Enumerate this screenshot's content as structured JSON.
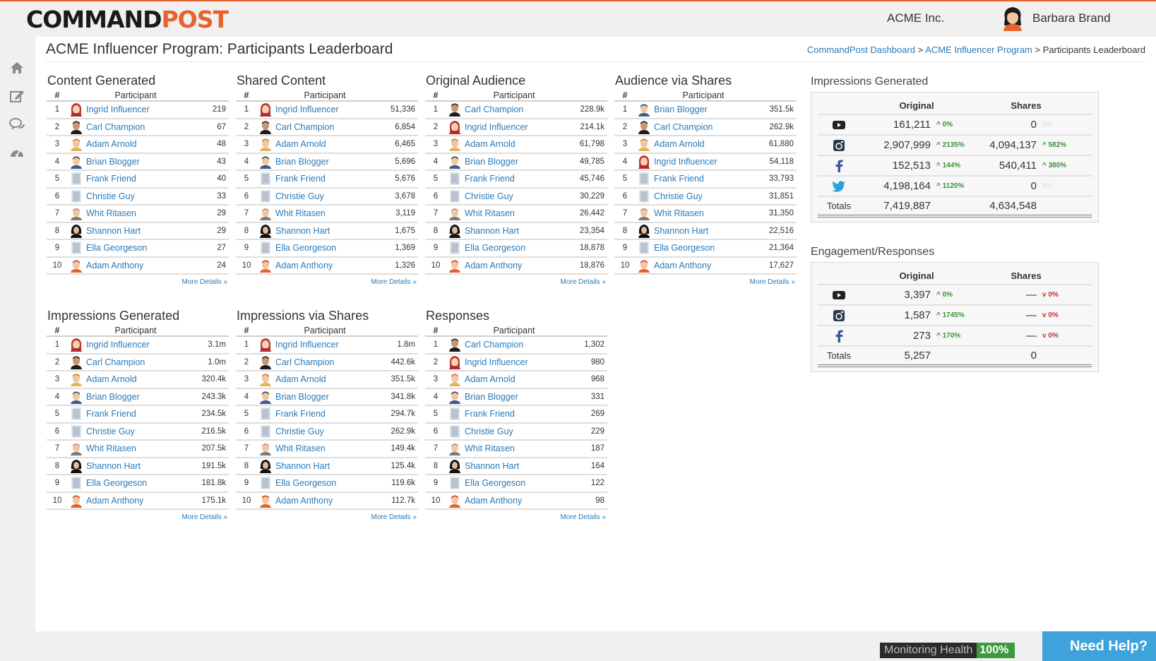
{
  "header": {
    "logo_left": "COMMAND",
    "logo_right": "POST",
    "company": "ACME Inc.",
    "user_name": "Barbara Brand"
  },
  "page": {
    "title": "ACME Influencer Program: Participants Leaderboard",
    "breadcrumb": {
      "link1": "CommandPost Dashboard",
      "sep": ">",
      "link2": "ACME Influencer Program",
      "current": "Participants Leaderboard"
    }
  },
  "sidebar": [
    "home-icon",
    "edit-icon",
    "chat-icon",
    "dashboard-icon"
  ],
  "board_labels": {
    "num_header": "#",
    "participant_header": "Participant",
    "more": "More Details »"
  },
  "boards": [
    {
      "title": "Content Generated",
      "rows": [
        {
          "n": "1",
          "name": "Ingrid Influencer",
          "avatar": "ingrid",
          "value": "219"
        },
        {
          "n": "2",
          "name": "Carl Champion",
          "avatar": "carl",
          "value": "67"
        },
        {
          "n": "3",
          "name": "Adam Arnold",
          "avatar": "adam",
          "value": "48"
        },
        {
          "n": "4",
          "name": "Brian Blogger",
          "avatar": "brian",
          "value": "43"
        },
        {
          "n": "5",
          "name": "Frank Friend",
          "avatar": "blank",
          "value": "40"
        },
        {
          "n": "6",
          "name": "Christie Guy",
          "avatar": "blank",
          "value": "33"
        },
        {
          "n": "7",
          "name": "Whit Ritasen",
          "avatar": "whit",
          "value": "29"
        },
        {
          "n": "8",
          "name": "Shannon Hart",
          "avatar": "shannon",
          "value": "29"
        },
        {
          "n": "9",
          "name": "Ella Georgeson",
          "avatar": "blank",
          "value": "27"
        },
        {
          "n": "10",
          "name": "Adam Anthony",
          "avatar": "anthony",
          "value": "24"
        }
      ]
    },
    {
      "title": "Shared Content",
      "rows": [
        {
          "n": "1",
          "name": "Ingrid Influencer",
          "avatar": "ingrid",
          "value": "51,336"
        },
        {
          "n": "2",
          "name": "Carl Champion",
          "avatar": "carl",
          "value": "6,854"
        },
        {
          "n": "3",
          "name": "Adam Arnold",
          "avatar": "adam",
          "value": "6,465"
        },
        {
          "n": "4",
          "name": "Brian Blogger",
          "avatar": "brian",
          "value": "5,696"
        },
        {
          "n": "5",
          "name": "Frank Friend",
          "avatar": "blank",
          "value": "5,676"
        },
        {
          "n": "6",
          "name": "Christie Guy",
          "avatar": "blank",
          "value": "3,678"
        },
        {
          "n": "7",
          "name": "Whit Ritasen",
          "avatar": "whit",
          "value": "3,119"
        },
        {
          "n": "8",
          "name": "Shannon Hart",
          "avatar": "shannon",
          "value": "1,675"
        },
        {
          "n": "9",
          "name": "Ella Georgeson",
          "avatar": "blank",
          "value": "1,369"
        },
        {
          "n": "10",
          "name": "Adam Anthony",
          "avatar": "anthony",
          "value": "1,326"
        }
      ]
    },
    {
      "title": "Original Audience",
      "rows": [
        {
          "n": "1",
          "name": "Carl Champion",
          "avatar": "carl",
          "value": "228.9k"
        },
        {
          "n": "2",
          "name": "Ingrid Influencer",
          "avatar": "ingrid",
          "value": "214.1k"
        },
        {
          "n": "3",
          "name": "Adam Arnold",
          "avatar": "adam",
          "value": "61,798"
        },
        {
          "n": "4",
          "name": "Brian Blogger",
          "avatar": "brian",
          "value": "49,785"
        },
        {
          "n": "5",
          "name": "Frank Friend",
          "avatar": "blank",
          "value": "45,746"
        },
        {
          "n": "6",
          "name": "Christie Guy",
          "avatar": "blank",
          "value": "30,229"
        },
        {
          "n": "7",
          "name": "Whit Ritasen",
          "avatar": "whit",
          "value": "26,442"
        },
        {
          "n": "8",
          "name": "Shannon Hart",
          "avatar": "shannon",
          "value": "23,354"
        },
        {
          "n": "9",
          "name": "Ella Georgeson",
          "avatar": "blank",
          "value": "18,878"
        },
        {
          "n": "10",
          "name": "Adam Anthony",
          "avatar": "anthony",
          "value": "18,876"
        }
      ]
    },
    {
      "title": "Audience via Shares",
      "rows": [
        {
          "n": "1",
          "name": "Brian Blogger",
          "avatar": "brian",
          "value": "351.5k"
        },
        {
          "n": "2",
          "name": "Carl Champion",
          "avatar": "carl",
          "value": "262.9k"
        },
        {
          "n": "3",
          "name": "Adam Arnold",
          "avatar": "adam",
          "value": "61,880"
        },
        {
          "n": "4",
          "name": "Ingrid Influencer",
          "avatar": "ingrid",
          "value": "54,118"
        },
        {
          "n": "5",
          "name": "Frank Friend",
          "avatar": "blank",
          "value": "33,793"
        },
        {
          "n": "6",
          "name": "Christie Guy",
          "avatar": "blank",
          "value": "31,851"
        },
        {
          "n": "7",
          "name": "Whit Ritasen",
          "avatar": "whit",
          "value": "31,350"
        },
        {
          "n": "8",
          "name": "Shannon Hart",
          "avatar": "shannon",
          "value": "22,516"
        },
        {
          "n": "9",
          "name": "Ella Georgeson",
          "avatar": "blank",
          "value": "21,364"
        },
        {
          "n": "10",
          "name": "Adam Anthony",
          "avatar": "anthony",
          "value": "17,627"
        }
      ]
    },
    {
      "title": "Impressions Generated",
      "rows": [
        {
          "n": "1",
          "name": "Ingrid Influencer",
          "avatar": "ingrid",
          "value": "3.1m"
        },
        {
          "n": "2",
          "name": "Carl Champion",
          "avatar": "carl",
          "value": "1.0m"
        },
        {
          "n": "3",
          "name": "Adam Arnold",
          "avatar": "adam",
          "value": "320.4k"
        },
        {
          "n": "4",
          "name": "Brian Blogger",
          "avatar": "brian",
          "value": "243.3k"
        },
        {
          "n": "5",
          "name": "Frank Friend",
          "avatar": "blank",
          "value": "234.5k"
        },
        {
          "n": "6",
          "name": "Christie Guy",
          "avatar": "blank",
          "value": "216.5k"
        },
        {
          "n": "7",
          "name": "Whit Ritasen",
          "avatar": "whit",
          "value": "207.5k"
        },
        {
          "n": "8",
          "name": "Shannon Hart",
          "avatar": "shannon",
          "value": "191.5k"
        },
        {
          "n": "9",
          "name": "Ella Georgeson",
          "avatar": "blank",
          "value": "181.8k"
        },
        {
          "n": "10",
          "name": "Adam Anthony",
          "avatar": "anthony",
          "value": "175.1k"
        }
      ]
    },
    {
      "title": "Impressions via Shares",
      "rows": [
        {
          "n": "1",
          "name": "Ingrid Influencer",
          "avatar": "ingrid",
          "value": "1.8m"
        },
        {
          "n": "2",
          "name": "Carl Champion",
          "avatar": "carl",
          "value": "442.6k"
        },
        {
          "n": "3",
          "name": "Adam Arnold",
          "avatar": "adam",
          "value": "351.5k"
        },
        {
          "n": "4",
          "name": "Brian Blogger",
          "avatar": "brian",
          "value": "341.8k"
        },
        {
          "n": "5",
          "name": "Frank Friend",
          "avatar": "blank",
          "value": "294.7k"
        },
        {
          "n": "6",
          "name": "Christie Guy",
          "avatar": "blank",
          "value": "262.9k"
        },
        {
          "n": "7",
          "name": "Whit Ritasen",
          "avatar": "whit",
          "value": "149.4k"
        },
        {
          "n": "8",
          "name": "Shannon Hart",
          "avatar": "shannon",
          "value": "125.4k"
        },
        {
          "n": "9",
          "name": "Ella Georgeson",
          "avatar": "blank",
          "value": "119.6k"
        },
        {
          "n": "10",
          "name": "Adam Anthony",
          "avatar": "anthony",
          "value": "112.7k"
        }
      ]
    },
    {
      "title": "Responses",
      "rows": [
        {
          "n": "1",
          "name": "Carl Champion",
          "avatar": "carl",
          "value": "1,302"
        },
        {
          "n": "2",
          "name": "Ingrid Influencer",
          "avatar": "ingrid",
          "value": "980"
        },
        {
          "n": "3",
          "name": "Adam Arnold",
          "avatar": "adam",
          "value": "968"
        },
        {
          "n": "4",
          "name": "Brian Blogger",
          "avatar": "brian",
          "value": "331"
        },
        {
          "n": "5",
          "name": "Frank Friend",
          "avatar": "blank",
          "value": "269"
        },
        {
          "n": "6",
          "name": "Christie Guy",
          "avatar": "blank",
          "value": "229"
        },
        {
          "n": "7",
          "name": "Whit Ritasen",
          "avatar": "whit",
          "value": "187"
        },
        {
          "n": "8",
          "name": "Shannon Hart",
          "avatar": "shannon",
          "value": "164"
        },
        {
          "n": "9",
          "name": "Ella Georgeson",
          "avatar": "blank",
          "value": "122"
        },
        {
          "n": "10",
          "name": "Adam Anthony",
          "avatar": "anthony",
          "value": "98"
        }
      ]
    }
  ],
  "summaries": [
    {
      "title": "Impressions Generated",
      "col_original": "Original",
      "col_shares": "Shares",
      "rows": [
        {
          "icon": "youtube-icon",
          "orig": "161,211",
          "og": "^ 0%",
          "shares": "0",
          "sg": "0%",
          "sg_style": "faint"
        },
        {
          "icon": "instagram-icon",
          "orig": "2,907,999",
          "og": "^ 2135%",
          "shares": "4,094,137",
          "sg": "^ 582%",
          "sg_style": "up"
        },
        {
          "icon": "facebook-icon",
          "orig": "152,513",
          "og": "^ 144%",
          "shares": "540,411",
          "sg": "^ 380%",
          "sg_style": "up"
        },
        {
          "icon": "twitter-icon",
          "orig": "4,198,164",
          "og": "^ 1120%",
          "shares": "0",
          "sg": "0%",
          "sg_style": "faint"
        }
      ],
      "totals_label": "Totals",
      "total_orig": "7,419,887",
      "total_shares": "4,634,548"
    },
    {
      "title": "Engagement/Responses",
      "col_original": "Original",
      "col_shares": "Shares",
      "rows": [
        {
          "icon": "youtube-icon",
          "orig": "3,397",
          "og": "^ 0%",
          "shares": "—",
          "sg": "v 0%",
          "sg_style": "red"
        },
        {
          "icon": "instagram-icon",
          "orig": "1,587",
          "og": "^ 1745%",
          "shares": "—",
          "sg": "v 0%",
          "sg_style": "red"
        },
        {
          "icon": "facebook-icon",
          "orig": "273",
          "og": "^ 170%",
          "shares": "—",
          "sg": "v 0%",
          "sg_style": "red"
        }
      ],
      "totals_label": "Totals",
      "total_orig": "5,257",
      "total_shares": "0"
    }
  ],
  "footer": {
    "health_label": "Monitoring Health",
    "health_value": "100%",
    "help": "Need Help?"
  }
}
